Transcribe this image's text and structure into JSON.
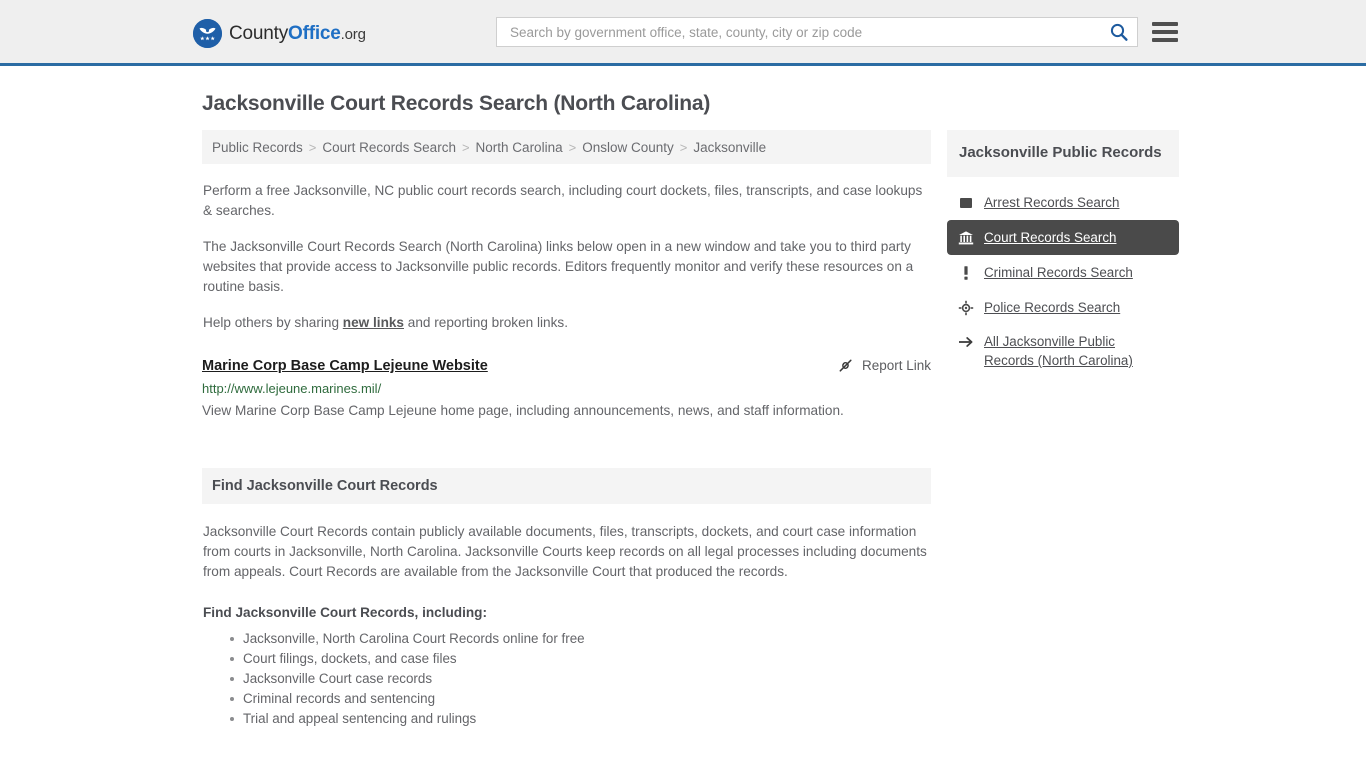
{
  "header": {
    "logo": {
      "icon": "eagle-shield-icon",
      "text_part1": "County",
      "text_part2": "Office",
      "text_part3": ".org"
    },
    "search": {
      "placeholder": "Search by government office, state, county, city or zip code",
      "value": "",
      "icon": "search-icon"
    },
    "menu_icon": "hamburger-menu-icon",
    "accent_color": "#2b6ca3",
    "background_color": "#efefef"
  },
  "page_title": "Jacksonville Court Records Search (North Carolina)",
  "breadcrumb": {
    "items": [
      {
        "label": "Public Records"
      },
      {
        "label": "Court Records Search"
      },
      {
        "label": "North Carolina"
      },
      {
        "label": "Onslow County"
      },
      {
        "label": "Jacksonville"
      }
    ],
    "separator": ">"
  },
  "intro": {
    "paragraph1": "Perform a free Jacksonville, NC public court records search, including court dockets, files, transcripts, and case lookups & searches.",
    "paragraph2": "The Jacksonville Court Records Search (North Carolina) links below open in a new window and take you to third party websites that provide access to Jacksonville public records. Editors frequently monitor and verify these resources on a routine basis.",
    "paragraph3_before": "Help others by sharing ",
    "paragraph3_link": "new links",
    "paragraph3_after": " and reporting broken links."
  },
  "result": {
    "title": "Marine Corp Base Camp Lejeune Website",
    "url": "http://www.lejeune.marines.mil/",
    "description": "View Marine Corp Base Camp Lejeune home page, including announcements, news, and staff information.",
    "report_label": "Report Link",
    "report_icon": "broken-link-icon",
    "url_color": "#2f6b3d"
  },
  "find_section": {
    "heading": "Find Jacksonville Court Records",
    "body": "Jacksonville Court Records contain publicly available documents, files, transcripts, dockets, and court case information from courts in Jacksonville, North Carolina. Jacksonville Courts keep records on all legal processes including documents from appeals. Court Records are available from the Jacksonville Court that produced the records.",
    "sub_heading": "Find Jacksonville Court Records, including:",
    "items": [
      "Jacksonville, North Carolina Court Records online for free",
      "Court filings, dockets, and case files",
      "Jacksonville Court case records",
      "Criminal records and sentencing",
      "Trial and appeal sentencing and rulings"
    ]
  },
  "sidebar": {
    "title": "Jacksonville Public Records",
    "active_background": "#4a4a4a",
    "items": [
      {
        "label": "Arrest Records Search",
        "icon": "fingerprint-square-icon",
        "active": false
      },
      {
        "label": "Court Records Search",
        "icon": "courthouse-icon",
        "active": true
      },
      {
        "label": "Criminal Records Search",
        "icon": "exclamation-icon",
        "active": false
      },
      {
        "label": "Police Records Search",
        "icon": "police-badge-icon",
        "active": false
      }
    ],
    "all_records": {
      "label_line1": "All Jacksonville Public",
      "label_line2": "Records (North Carolina)",
      "icon": "arrow-right-icon"
    }
  }
}
